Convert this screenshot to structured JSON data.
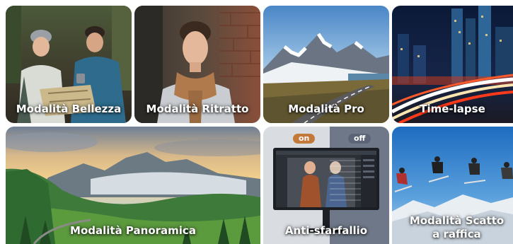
{
  "tiles": {
    "beauty": {
      "label": "Modalità Bellezza",
      "image": "couple-hiking-photo"
    },
    "portrait": {
      "label": "Modalità Ritratto",
      "image": "young-man-scarf-photo"
    },
    "pro": {
      "label": "Modalità Pro",
      "image": "mountain-road-photo"
    },
    "timelapse": {
      "label": "Time-lapse",
      "image": "city-night-light-trails-photo"
    },
    "panorama": {
      "label": "Modalità Panoramica",
      "image": "mountain-valley-sunset-photo"
    },
    "antiflicker": {
      "label": "Anti-sfarfallio",
      "image": "monitor-comparison-photo",
      "toggle_on": "on",
      "toggle_off": "off"
    },
    "burst": {
      "label": "Modalità Scatto a raffica",
      "image": "skiers-jumping-photo"
    }
  },
  "colors": {
    "pill_on": "#c2793a",
    "pill_off": "#5c6577",
    "caption": "#ffffff"
  }
}
